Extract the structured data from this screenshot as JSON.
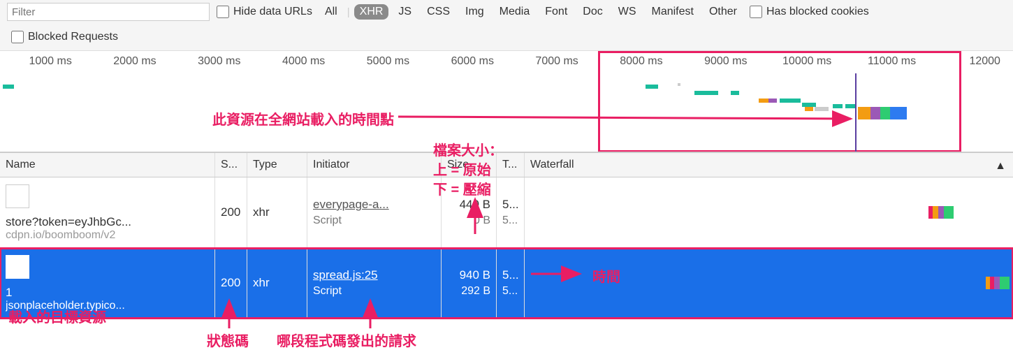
{
  "toolbar": {
    "filter_placeholder": "Filter",
    "hide_data_urls": "Hide data URLs",
    "has_blocked_cookies": "Has blocked cookies",
    "blocked_requests": "Blocked Requests",
    "types": [
      "All",
      "XHR",
      "JS",
      "CSS",
      "Img",
      "Media",
      "Font",
      "Doc",
      "WS",
      "Manifest",
      "Other"
    ],
    "active_type": "XHR"
  },
  "timeline": {
    "ticks": [
      "1000 ms",
      "2000 ms",
      "3000 ms",
      "4000 ms",
      "5000 ms",
      "6000 ms",
      "7000 ms",
      "8000 ms",
      "9000 ms",
      "10000 ms",
      "11000 ms",
      "12000"
    ]
  },
  "columns": {
    "name": "Name",
    "status": "S...",
    "type": "Type",
    "initiator": "Initiator",
    "size": "Size",
    "time": "T...",
    "waterfall": "Waterfall"
  },
  "rows": [
    {
      "name_main": "store?token=eyJhbGc...",
      "name_sub": "cdpn.io/boomboom/v2",
      "status": "200",
      "type": "xhr",
      "initiator_main": "everypage-a...",
      "initiator_sub": "Script",
      "size_main": "440 B",
      "size_sub": "0 B",
      "time_main": "5...",
      "time_sub": "5..."
    },
    {
      "name_main": "1",
      "name_sub": "jsonplaceholder.typico...",
      "status": "200",
      "type": "xhr",
      "initiator_main": "spread.js:25",
      "initiator_sub": "Script",
      "size_main": "940 B",
      "size_sub": "292 B",
      "time_main": "5...",
      "time_sub": "5..."
    }
  ],
  "annotations": {
    "timeline_point": "此資源在全網站載入的時間點",
    "file_size_title": "檔案大小：",
    "file_size_top": "上 = 原始",
    "file_size_bottom": "下 = 壓縮",
    "target_resource": "載入的目標資源",
    "status_code": "狀態碼",
    "which_code": "哪段程式碼發出的請求",
    "time": "時間"
  }
}
